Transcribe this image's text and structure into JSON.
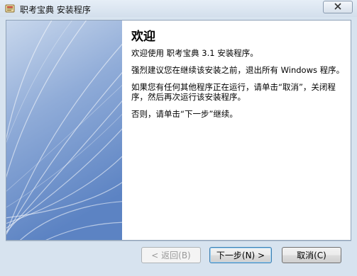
{
  "window": {
    "title": "职考宝典 安装程序"
  },
  "page": {
    "heading": "欢迎",
    "paragraphs": [
      "欢迎使用 职考宝典 3.1 安装程序。",
      "强烈建议您在继续该安装之前，退出所有 Windows 程序。",
      "如果您有任何其他程序正在运行，请单击“取消”，关闭程序，然后再次运行该安装程序。",
      "否则，请单击“下一步”继续。"
    ]
  },
  "buttons": {
    "back": "< 返回(B)",
    "next": "下一步(N) >",
    "cancel": "取消(C)"
  },
  "colors": {
    "banner_top": "#c3d3ea",
    "banner_bottom": "#5f86c4",
    "client_bg": "#ffffff",
    "frame_bg": "#d7e3ef"
  }
}
